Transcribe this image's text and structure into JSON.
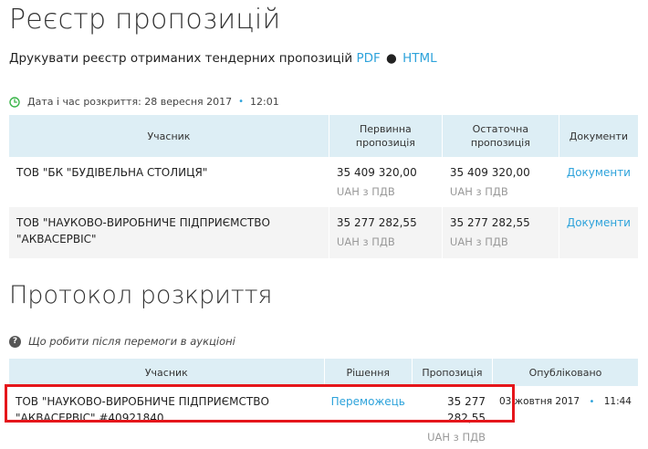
{
  "registry": {
    "title": "Реєстр пропозицій",
    "print_text": "Друкувати реєстр отриманих тендерних пропозицій",
    "pdf_link": "PDF",
    "separator": "●",
    "html_link": "HTML",
    "opening_label": "Дата і час розкриття: 28 вересня 2017",
    "opening_time": "12:01",
    "columns": [
      "Учасник",
      "Первинна пропозиція",
      "Остаточна пропозиція",
      "Документи"
    ],
    "rows": [
      {
        "participant": "ТОВ \"БК \"БУДІВЕЛЬНА СТОЛИЦЯ\"",
        "initial": "35 409 320,00",
        "initial_note": "UAH з ПДВ",
        "final": "35 409 320,00",
        "final_note": "UAH з ПДВ",
        "docs": "Документи"
      },
      {
        "participant": "ТОВ \"НАУКОВО-ВИРОБНИЧЕ ПІДПРИЄМСТВО \"АКВАСЕРВІС\"",
        "initial": "35 277 282,55",
        "initial_note": "UAH з ПДВ",
        "final": "35 277 282,55",
        "final_note": "UAH з ПДВ",
        "docs": "Документи"
      }
    ]
  },
  "protocol": {
    "title": "Протокол розкриття",
    "help_text": "Що робити після перемоги в аукціоні",
    "columns": [
      "Учасник",
      "Рішення",
      "Пропозиція",
      "Опубліковано"
    ],
    "row": {
      "participant": "ТОВ \"НАУКОВО-ВИРОБНИЧЕ ПІДПРИЄМСТВО \"АКВАСЕРВІС\" #40921840",
      "decision": "Переможець",
      "offer": "35 277 282,55",
      "offer_note": "UAH з ПДВ",
      "published_date": "03 жовтня 2017",
      "published_time": "11:44"
    }
  },
  "colors": {
    "link": "#2ea3db",
    "header_bg": "#ddeef5",
    "highlight": "#e5161b"
  },
  "icons": {
    "clock": "clock-icon",
    "question": "question-icon"
  }
}
